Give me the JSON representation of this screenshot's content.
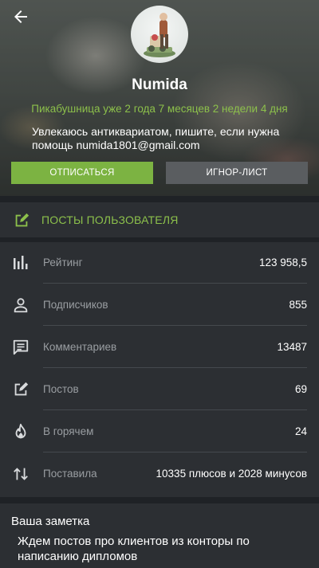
{
  "header": {
    "username": "Numida",
    "subtitle": "Пикабушница уже 2 года 7 месяцев 2 недели 4 дня",
    "about": "Увлекаюсь антиквариатом, пишите, если нужна помощь numida1801@gmail.com",
    "unsubscribe_label": "ОТПИСАТЬСЯ",
    "ignore_label": "ИГНОР-ЛИСТ",
    "back_icon": "back-arrow-icon",
    "accent_color": "#8cc04b"
  },
  "posts_link": {
    "label": "ПОСТЫ ПОЛЬЗОВАТЕЛЯ",
    "icon": "edit-icon"
  },
  "stats": [
    {
      "icon": "rating-bars-icon",
      "label": "Рейтинг",
      "value": "123 958,5"
    },
    {
      "icon": "person-icon",
      "label": "Подписчиков",
      "value": "855"
    },
    {
      "icon": "comment-icon",
      "label": "Комментариев",
      "value": "13487"
    },
    {
      "icon": "edit-icon",
      "label": "Постов",
      "value": "69"
    },
    {
      "icon": "fire-icon",
      "label": "В горячем",
      "value": "24"
    },
    {
      "icon": "swap-vertical-icon",
      "label": "Поставила",
      "value": "10335 плюсов и 2028 минусов"
    }
  ],
  "note": {
    "title": "Ваша заметка",
    "text": "Ждем постов про клиентов из конторы по написанию дипломов"
  }
}
